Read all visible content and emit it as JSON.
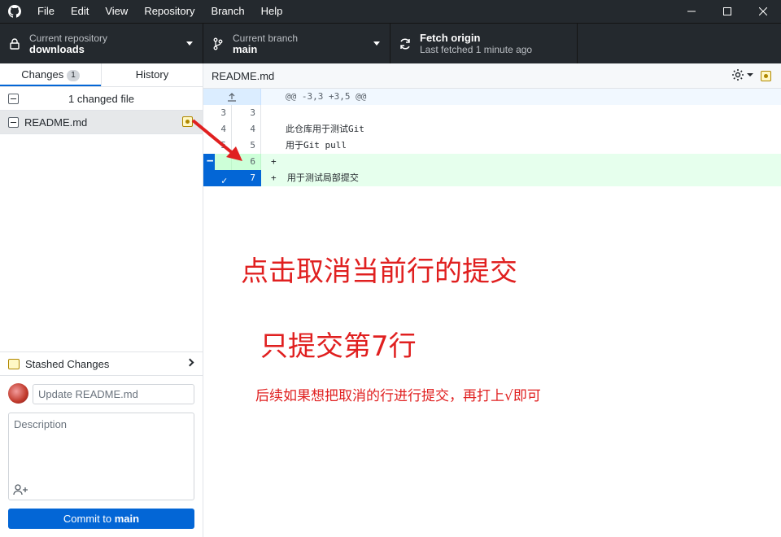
{
  "menu": [
    "File",
    "Edit",
    "View",
    "Repository",
    "Branch",
    "Help"
  ],
  "toolbar": {
    "repo_label": "Current repository",
    "repo_value": "downloads",
    "branch_label": "Current branch",
    "branch_value": "main",
    "fetch_label": "Fetch origin",
    "fetch_sub": "Last fetched 1 minute ago"
  },
  "sidebar": {
    "tab_changes": "Changes",
    "tab_changes_count": "1",
    "tab_history": "History",
    "changed_count_text": "1 changed file",
    "file_name": "README.md",
    "stash_label": "Stashed Changes",
    "summary_placeholder": "Update README.md",
    "description_placeholder": "Description",
    "commit_prefix": "Commit to ",
    "commit_branch": "main"
  },
  "diff": {
    "file_path": "README.md",
    "hunk_header": "@@ -3,3 +3,5 @@",
    "lines": [
      {
        "old": "3",
        "new": "3",
        "text": ""
      },
      {
        "old": "4",
        "new": "4",
        "text": "此仓库用于测试Git"
      },
      {
        "old": "5",
        "new": "5",
        "text": "用于Git pull"
      },
      {
        "old": "",
        "new": "6",
        "text": "+"
      },
      {
        "old": "",
        "new": "7",
        "text": "+  用于测试局部提交"
      }
    ]
  },
  "annotations": {
    "line1": "点击取消当前行的提交",
    "line2": "只提交第7行",
    "line3": "后续如果想把取消的行进行提交，再打上√即可",
    "color": "#e02020"
  }
}
